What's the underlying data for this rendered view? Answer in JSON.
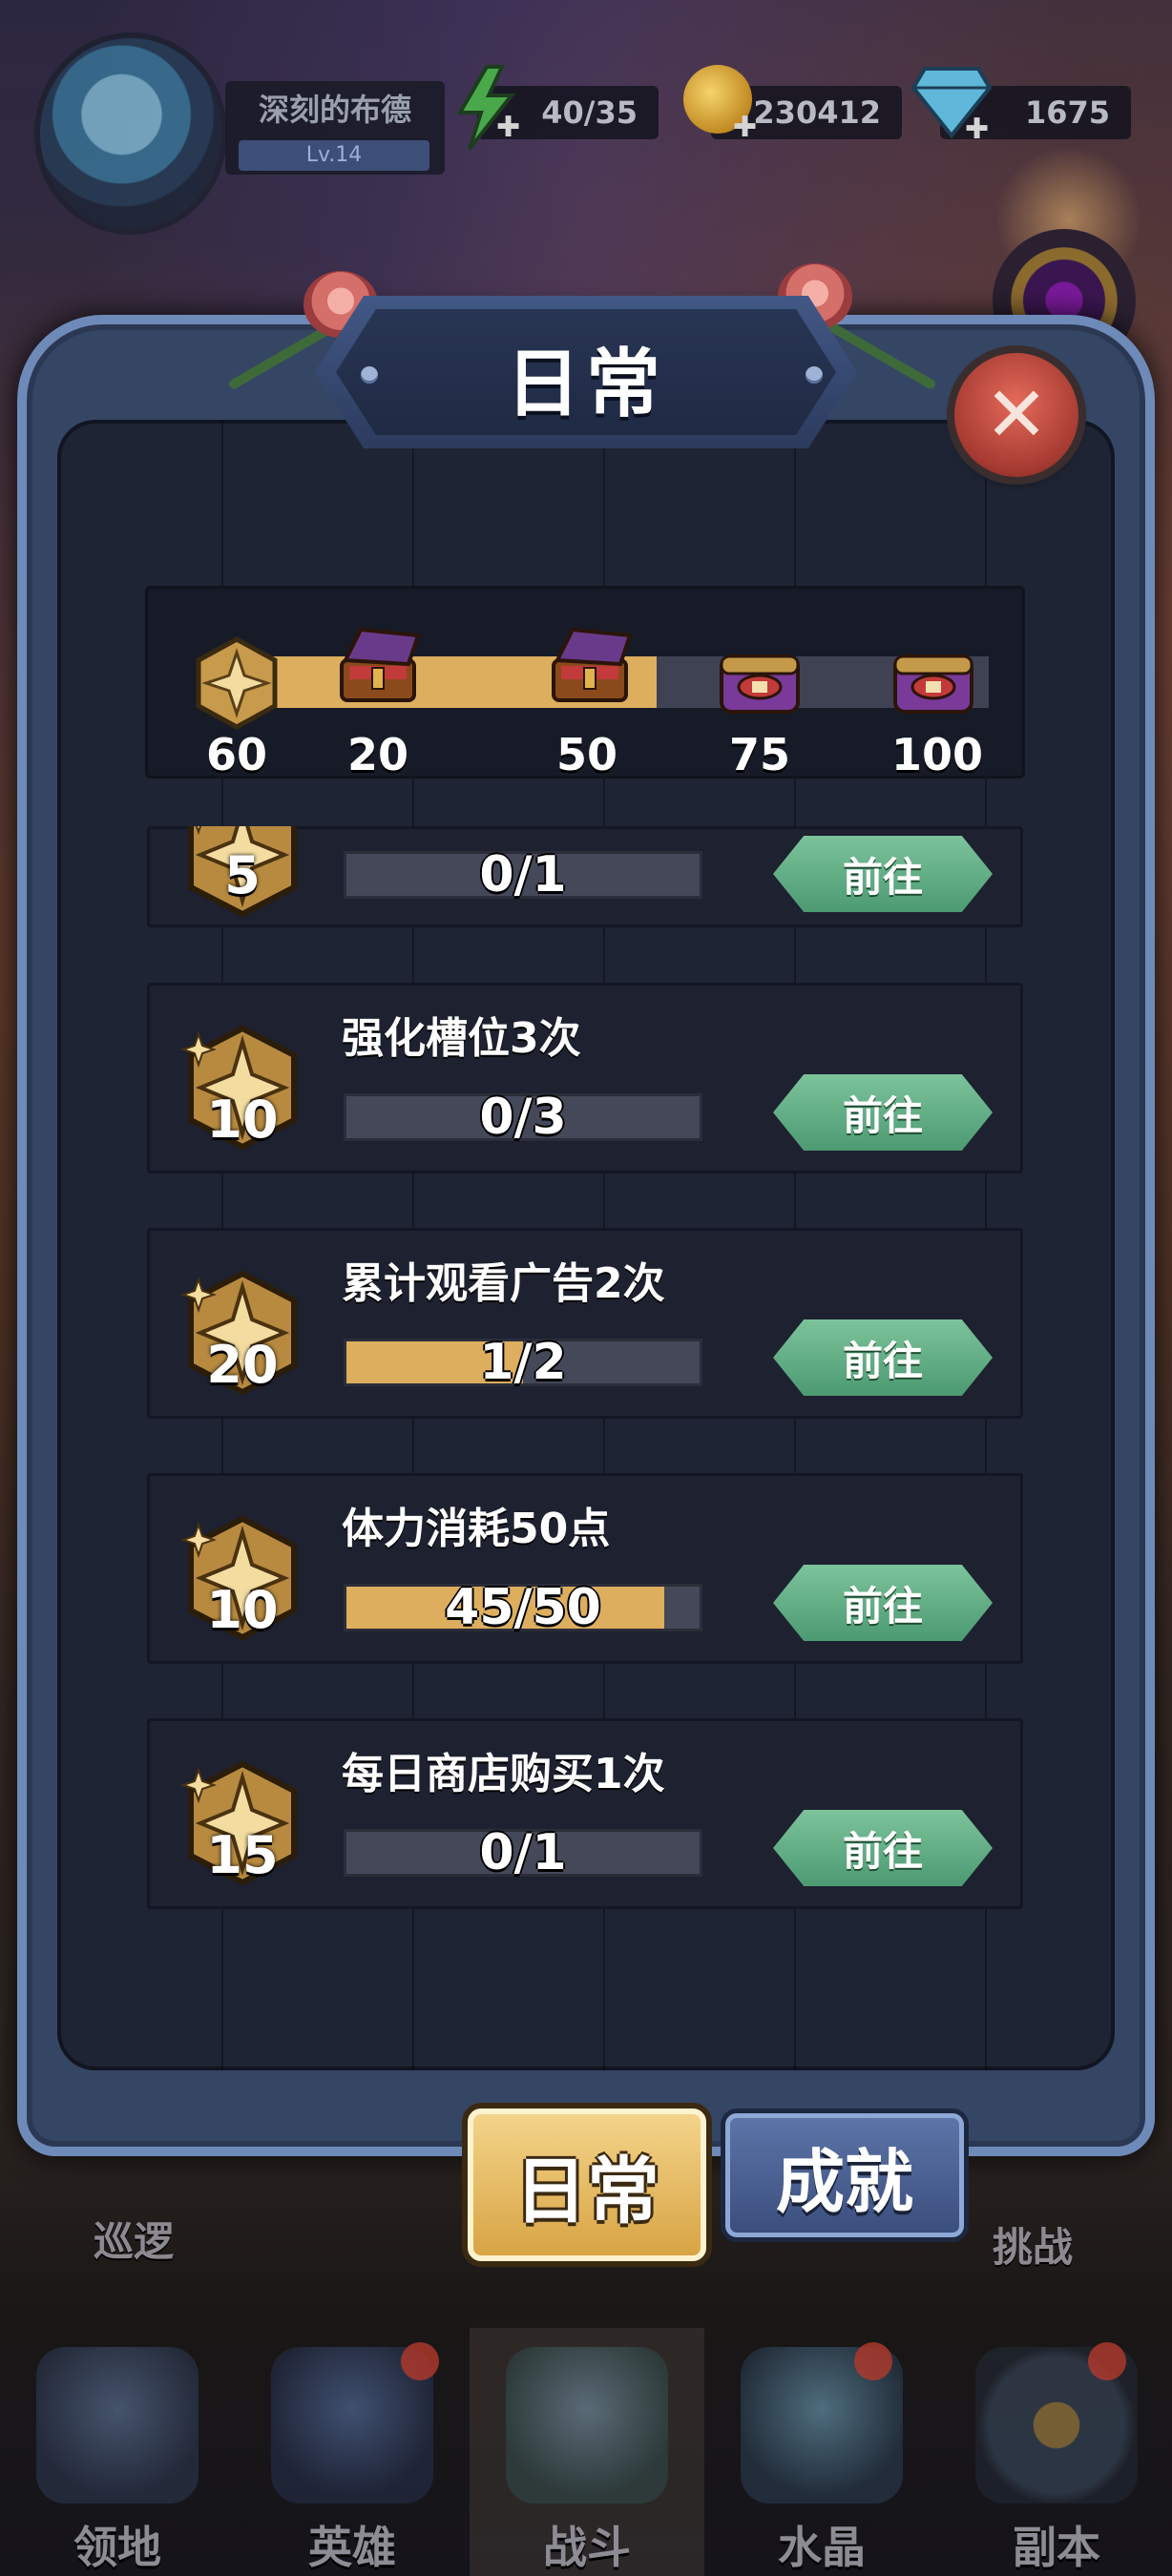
{
  "header": {
    "player_name": "深刻的布德",
    "level": "Lv.14",
    "stamina": "40/35",
    "coins": "230412",
    "gems": "1675"
  },
  "dialog": {
    "title": "日常",
    "close_icon": "close-icon"
  },
  "activity": {
    "current": "60",
    "current_fraction": 0.565,
    "milestones": [
      {
        "value": "20",
        "state": "opened"
      },
      {
        "value": "50",
        "state": "opened"
      },
      {
        "value": "75",
        "state": "locked"
      },
      {
        "value": "100",
        "state": "locked"
      }
    ]
  },
  "tasks": [
    {
      "reward": "5",
      "title": "",
      "progress": "0/1",
      "fraction": 0.0,
      "button": "前往"
    },
    {
      "reward": "10",
      "title": "强化槽位3次",
      "progress": "0/3",
      "fraction": 0.0,
      "button": "前往"
    },
    {
      "reward": "20",
      "title": "累计观看广告2次",
      "progress": "1/2",
      "fraction": 0.5,
      "button": "前往"
    },
    {
      "reward": "10",
      "title": "体力消耗50点",
      "progress": "45/50",
      "fraction": 0.9,
      "button": "前往"
    },
    {
      "reward": "15",
      "title": "每日商店购买1次",
      "progress": "0/1",
      "fraction": 0.0,
      "button": "前往"
    }
  ],
  "tabs": {
    "daily": "日常",
    "achievement": "成就",
    "active": "daily"
  },
  "side_labels": {
    "left": "巡逻",
    "right": "挑战"
  },
  "nav": [
    {
      "label": "领地",
      "icon": "territory-icon"
    },
    {
      "label": "英雄",
      "icon": "hero-icon"
    },
    {
      "label": "战斗",
      "icon": "battle-icon",
      "active": true
    },
    {
      "label": "水晶",
      "icon": "crystal-icon"
    },
    {
      "label": "副本",
      "icon": "dungeon-icon"
    }
  ],
  "colors": {
    "progress_fill": "#dcae5e",
    "go_button": "#5fae84",
    "frame": "#354564"
  }
}
